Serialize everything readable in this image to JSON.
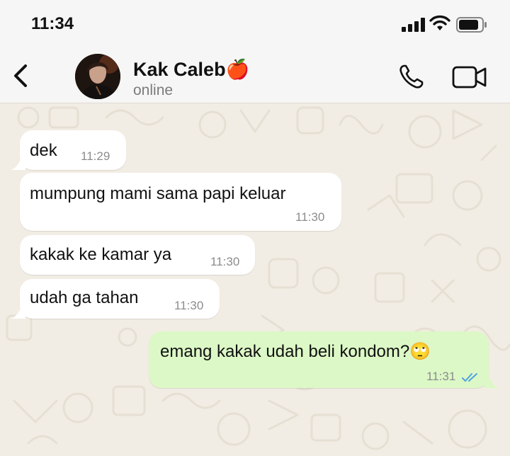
{
  "status_bar": {
    "time": "11:34"
  },
  "header": {
    "contact_name": "Kak Caleb🍎",
    "contact_status": "online",
    "icons": [
      "back-chevron-icon",
      "phone-icon",
      "video-camera-icon"
    ]
  },
  "messages": [
    {
      "direction": "incoming",
      "text": "dek",
      "time": "11:29"
    },
    {
      "direction": "incoming",
      "text": "mumpung mami sama papi keluar",
      "time": "11:30"
    },
    {
      "direction": "incoming",
      "text": "kakak ke kamar ya",
      "time": "11:30"
    },
    {
      "direction": "incoming",
      "text": "udah ga tahan",
      "time": "11:30"
    },
    {
      "direction": "outgoing",
      "text": "emang kakak udah beli kondom?🙄",
      "time": "11:31",
      "read_status": "read"
    }
  ],
  "colors": {
    "incoming_bubble": "#ffffff",
    "outgoing_bubble": "#dcf8c6",
    "read_ticks": "#4fa3e0",
    "wallpaper": "#f2ede4"
  }
}
